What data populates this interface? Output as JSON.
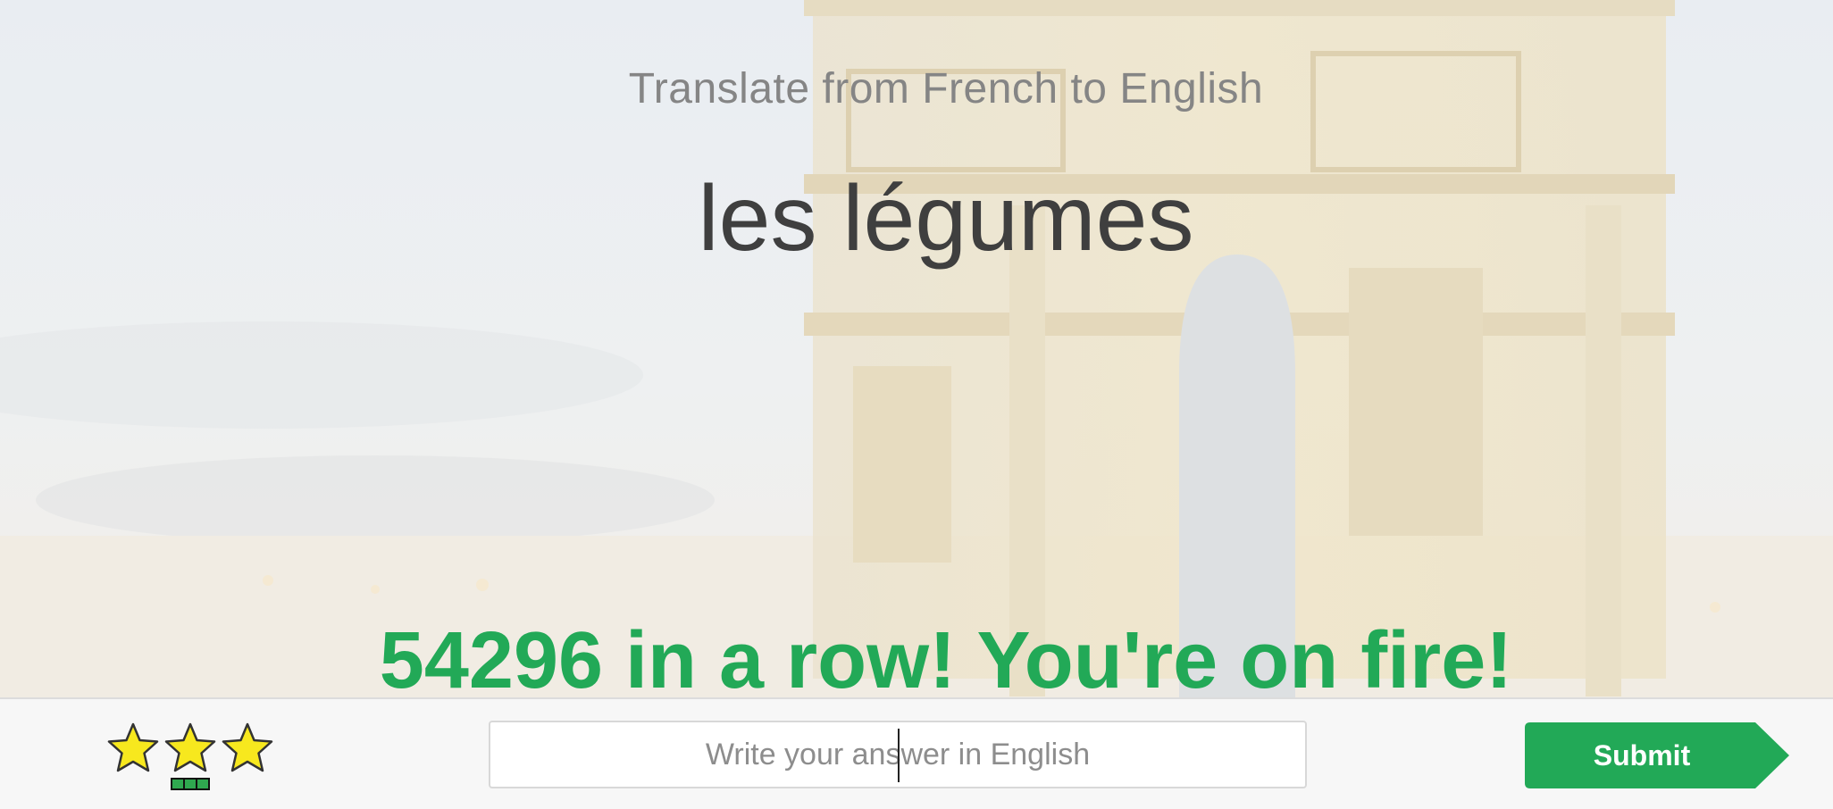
{
  "exercise": {
    "prompt": "Translate from French to English",
    "word": "les légumes"
  },
  "streak": {
    "message": "54296 in a row! You're on fire!"
  },
  "answer": {
    "placeholder": "Write your answer in English",
    "value": ""
  },
  "submit": {
    "label": "Submit"
  },
  "rating": {
    "stars_filled": 3,
    "stars_total": 3,
    "progress_segments_filled": 3,
    "progress_segments_total": 3
  },
  "colors": {
    "accent_green": "#22a957",
    "star_yellow": "#f7e81e"
  },
  "background": {
    "scene": "arc-de-triomphe-photo"
  }
}
